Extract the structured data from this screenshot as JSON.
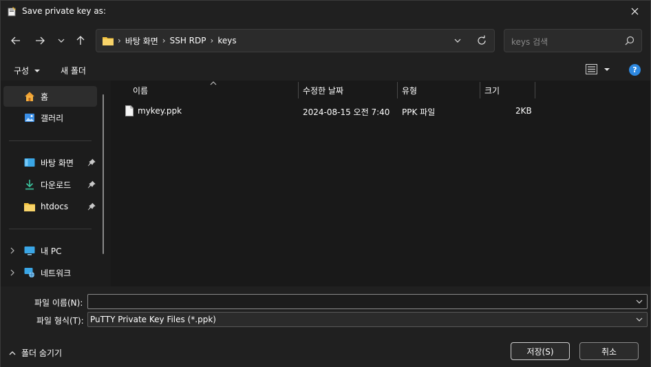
{
  "window": {
    "title": "Save private key as:"
  },
  "address": {
    "breadcrumbs": [
      "바탕 화면",
      "SSH RDP",
      "keys"
    ]
  },
  "search": {
    "placeholder": "keys 검색"
  },
  "toolbar": {
    "organize_label": "구성",
    "new_folder_label": "새 폴더",
    "help_label": "?"
  },
  "sidebar": {
    "items": [
      {
        "label": "홈",
        "icon": "home-icon"
      },
      {
        "label": "갤러리",
        "icon": "gallery-icon"
      },
      {
        "label": "바탕 화면",
        "icon": "desktop-icon"
      },
      {
        "label": "다운로드",
        "icon": "download-icon"
      },
      {
        "label": "htdocs",
        "icon": "folder-icon"
      },
      {
        "label": "내 PC",
        "icon": "pc-icon"
      },
      {
        "label": "네트워크",
        "icon": "network-icon"
      }
    ]
  },
  "columns": {
    "name": "이름",
    "modified": "수정한 날짜",
    "type": "유형",
    "size": "크기"
  },
  "files": [
    {
      "name": "mykey.ppk",
      "modified": "2024-08-15 오전 7:40",
      "type": "PPK 파일",
      "size": "2KB"
    }
  ],
  "form": {
    "filename_label": "파일 이름(N):",
    "filename_value": "",
    "filetype_label": "파일 형식(T):",
    "filetype_value": "PuTTY Private Key Files (*.ppk)"
  },
  "footer": {
    "hide_folders_label": "폴더 숨기기",
    "save_label": "저장(S)",
    "cancel_label": "취소"
  },
  "colors": {
    "background": "#202020",
    "list_background": "#191919",
    "accent": "#2d88e0",
    "folder": "#f4c542"
  }
}
